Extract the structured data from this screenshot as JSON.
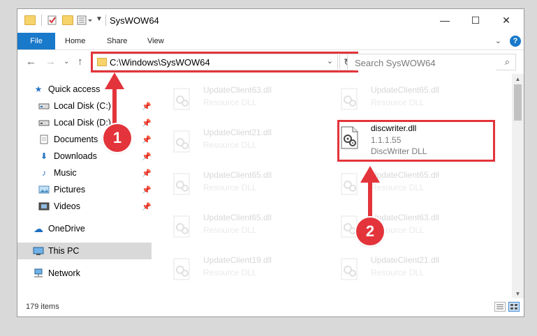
{
  "window": {
    "title": "SysWOW64",
    "controls": {
      "minimize": "—",
      "maximize": "☐",
      "close": "✕"
    }
  },
  "ribbon": {
    "tabs": [
      "File",
      "Home",
      "Share",
      "View"
    ],
    "help": "?"
  },
  "navigation": {
    "address_path": "C:\\Windows\\SysWOW64",
    "search_placeholder": "Search SysWOW64"
  },
  "sidebar": {
    "items": [
      {
        "label": "Quick access",
        "icon": "star-icon"
      },
      {
        "label": "Local Disk (C:)",
        "icon": "drive-icon",
        "pinned": true
      },
      {
        "label": "Local Disk (D:)",
        "icon": "drive-icon",
        "pinned": true
      },
      {
        "label": "Documents",
        "icon": "documents-icon",
        "pinned": true
      },
      {
        "label": "Downloads",
        "icon": "download-icon",
        "pinned": true
      },
      {
        "label": "Music",
        "icon": "music-icon",
        "pinned": true
      },
      {
        "label": "Pictures",
        "icon": "pictures-icon",
        "pinned": true
      },
      {
        "label": "Videos",
        "icon": "videos-icon",
        "pinned": true
      },
      {
        "label": "OneDrive",
        "icon": "cloud-icon"
      },
      {
        "label": "This PC",
        "icon": "computer-icon",
        "selected": true
      },
      {
        "label": "Network",
        "icon": "network-icon"
      }
    ]
  },
  "files": [
    {
      "name": "UpdateClient63.dll",
      "type": "Resource DLL",
      "faded": true
    },
    {
      "name": "UpdateClient65.dll",
      "type": "Resource DLL",
      "faded": true
    },
    {
      "name": "UpdateClient21.dll",
      "type": "Resource DLL",
      "faded": true
    },
    {
      "name": "discwriter.dll",
      "version": "1.1.1.55",
      "type": "DiscWriter DLL",
      "faded": false
    },
    {
      "name": "UpdateClient65.dll",
      "type": "Resource DLL",
      "faded": true
    },
    {
      "name": "UpdateClient65.dll",
      "type": "Resource DLL",
      "faded": true
    },
    {
      "name": "UpdateClient65.dll",
      "type": "Resource DLL",
      "faded": true
    },
    {
      "name": "UpdateClient63.dll",
      "type": "Resource DLL",
      "faded": true
    },
    {
      "name": "UpdateClient19.dll",
      "type": "Resource DLL",
      "faded": true
    },
    {
      "name": "UpdateClient21.dll",
      "type": "Resource DLL",
      "faded": true
    }
  ],
  "status": {
    "item_count": "179 items"
  },
  "callouts": {
    "step1": "1",
    "step2": "2"
  },
  "colors": {
    "accent_red": "#e3343b",
    "ribbon_blue": "#1979ca",
    "folder_yellow": "#f6d36b"
  }
}
